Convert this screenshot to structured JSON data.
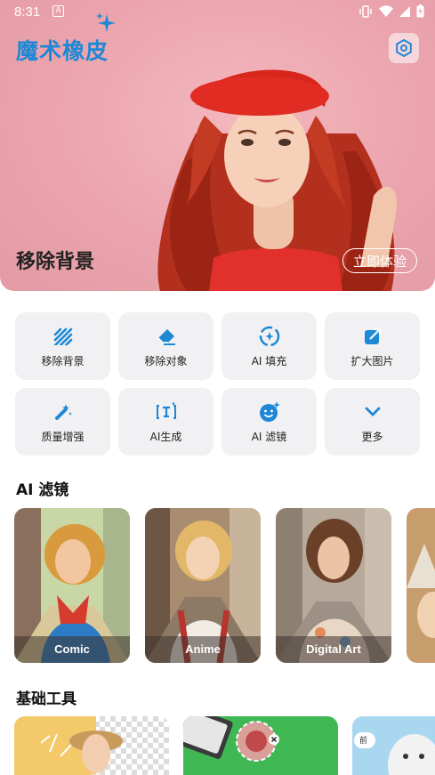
{
  "status_bar": {
    "time": "8:31",
    "notification": "A"
  },
  "app": {
    "title": "魔术橡皮"
  },
  "hero": {
    "caption": "移除背景",
    "cta_label": "立即体验"
  },
  "tools": [
    {
      "label": "移除背景",
      "icon": "stripes-icon"
    },
    {
      "label": "移除对象",
      "icon": "eraser-icon"
    },
    {
      "label": "AI 填充",
      "icon": "magic-fill-icon"
    },
    {
      "label": "扩大图片",
      "icon": "expand-image-icon"
    },
    {
      "label": "质量增强",
      "icon": "magic-wand-icon"
    },
    {
      "label": "AI生成",
      "icon": "text-generate-icon"
    },
    {
      "label": "AI 滤镜",
      "icon": "smiley-sparkle-icon"
    },
    {
      "label": "更多",
      "icon": "chevron-down-icon"
    }
  ],
  "ai_filters": {
    "title": "AI 滤镜",
    "items": [
      {
        "label": "Comic"
      },
      {
        "label": "Anime"
      },
      {
        "label": "Digital Art"
      }
    ]
  },
  "basic_tools": {
    "title": "基础工具",
    "before_label": "前"
  },
  "colors": {
    "accent": "#1e88d6",
    "hero_bg": "#eba4ad",
    "tile_bg": "#f1f1f3"
  }
}
